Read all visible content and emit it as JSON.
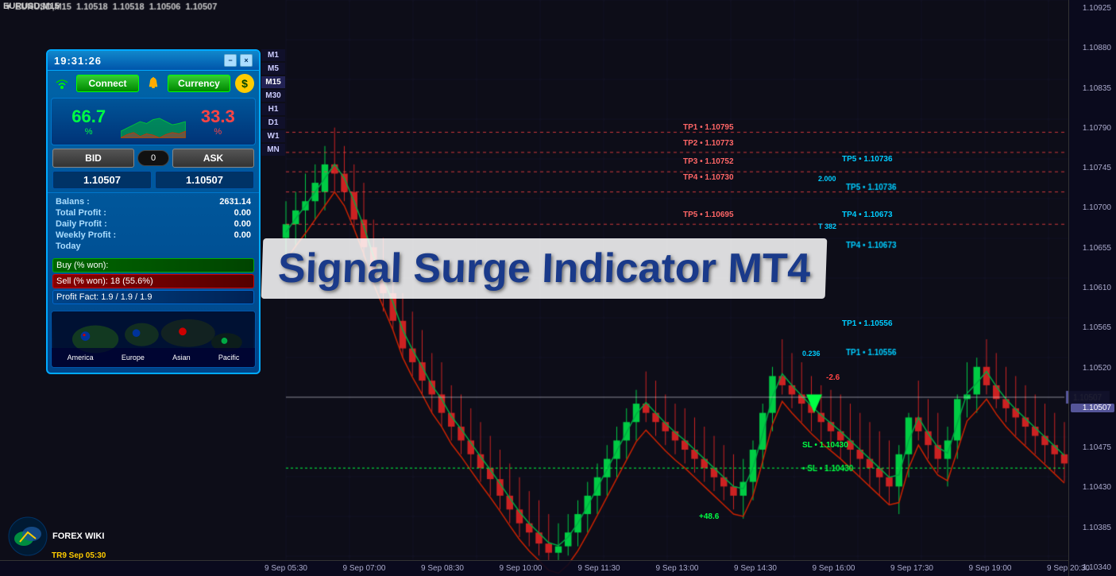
{
  "title_bar": {
    "symbol": "EURUSD,M15",
    "price_info": "1.10518 1.10518 1.10506 1.10507"
  },
  "panel": {
    "time": "19:31:26",
    "minimize_label": "−",
    "close_label": "×",
    "connect_label": "Connect",
    "currency_label": "Currency",
    "dollar_symbol": "$",
    "buy_pct": "66.7",
    "buy_pct_sign": "%",
    "sell_pct": "33.3",
    "sell_pct_sign": "%",
    "bid_label": "BID",
    "ask_label": "ASK",
    "spread": "0",
    "bid_price": "1.10507",
    "ask_price": "1.10507",
    "balance_label": "Balans :",
    "balance_val": "2631.14",
    "total_profit_label": "Total Profit :",
    "total_profit_val": "0.00",
    "daily_profit_label": "Daily Profit :",
    "daily_profit_val": "0.00",
    "weekly_profit_label": "Weekly Profit :",
    "weekly_profit_val": "0.00",
    "today_label": "Today",
    "buy_won_label": "Buy (% won):",
    "buy_won_val": "",
    "sell_won_label": "Sell (% won):",
    "sell_won_val": "18 (55.6%)",
    "profit_fact_label": "Profit Fact:",
    "profit_fact_val": "1.9 / 1.9 / 1.9",
    "regions": [
      "America",
      "Europe",
      "Asian",
      "Pacific"
    ]
  },
  "timeframes": [
    "M1",
    "M5",
    "M15",
    "M30",
    "H1",
    "D1",
    "W1",
    "MN"
  ],
  "active_tf": "M15",
  "signal_title": "Signal Surge Indicator MT4",
  "price_scale": {
    "prices": [
      "1.10925",
      "1.10880",
      "1.10835",
      "1.10790",
      "1.10745",
      "1.10700",
      "1.10655",
      "1.10610",
      "1.10565",
      "1.10520",
      "1.10507",
      "1.10475",
      "1.10430",
      "1.10385",
      "1.10340"
    ],
    "current_price": "1.10507"
  },
  "time_scale": {
    "times": [
      "9 Sep 05:30",
      "9 Sep 07:00",
      "9 Sep 08:30",
      "9 Sep 10:00",
      "9 Sep 11:30",
      "9 Sep 13:00",
      "9 Sep 14:30",
      "9 Sep 16:00",
      "9 Sep 17:30",
      "9 Sep 19:00",
      "9 Sep 20:30"
    ]
  },
  "chart_labels": {
    "tp1_left": "TP1 • 1.10795",
    "tp2_left": "TP2 • 1.10773",
    "tp3_left": "TP3 • 1.10752",
    "tp4_left": "TP4 • 1.10730",
    "tp5_left": "TP5 • 1.10695",
    "tp5_right": "TP5 • 1.10736",
    "tp4_right": "TP4 • 1.10673",
    "tp1_right": "TP1 • 1.10556",
    "sl_label": "SL • 1.10430",
    "val_2000": "2.000",
    "val_3825": "T 382",
    "val_0236": "0.236",
    "val_neg26": "-2.6",
    "val_pos486": "+48.6"
  },
  "forex_logo": {
    "text": "FOREX WIKI",
    "bottom_text": "TR9 Sep 05:30"
  },
  "colors": {
    "buy_green": "#00ff44",
    "sell_red": "#ff4444",
    "panel_bg": "#0055aa",
    "panel_border": "#00aaff",
    "chart_bg": "#0d0d1a",
    "grid": "#1a1a33",
    "up_candle": "#00cc44",
    "down_candle": "#cc2222"
  }
}
